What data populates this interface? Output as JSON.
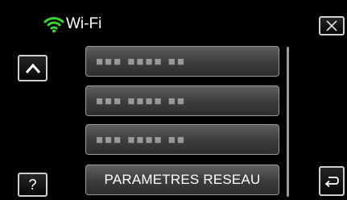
{
  "header": {
    "title": "Wi-Fi",
    "icon": "wifi-icon"
  },
  "controls": {
    "close_icon": "close-icon",
    "up_icon": "chevron-up-icon",
    "help_label": "?",
    "back_icon": "return-icon"
  },
  "list": {
    "items": [
      {
        "label": "■■■ ■■■■ ■■"
      },
      {
        "label": "■■■ ■■■■ ■■"
      },
      {
        "label": "■■■ ■■■■ ■■"
      },
      {
        "label": "PARAMETRES RESEAU"
      }
    ]
  },
  "colors": {
    "accent": "#3bd13b",
    "background": "#000000"
  }
}
